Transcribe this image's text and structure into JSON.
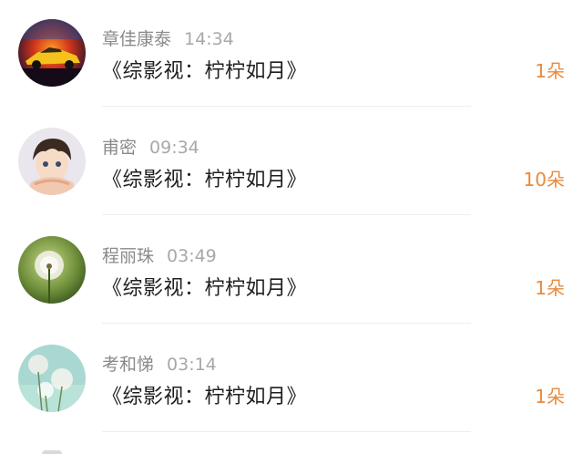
{
  "items": [
    {
      "user": "章佳康泰",
      "time": "14:34",
      "title": "《综影视：柠柠如月》",
      "count": "1朵"
    },
    {
      "user": "甫密",
      "time": "09:34",
      "title": "《综影视：柠柠如月》",
      "count": "10朵"
    },
    {
      "user": "程丽珠",
      "time": "03:49",
      "title": "《综影视：柠柠如月》",
      "count": "1朵"
    },
    {
      "user": "考和悌",
      "time": "03:14",
      "title": "《综影视：柠柠如月》",
      "count": "1朵"
    }
  ],
  "colors": {
    "count": "#e88a3c",
    "name": "#8a8a8a",
    "title": "#1f1f1f"
  }
}
